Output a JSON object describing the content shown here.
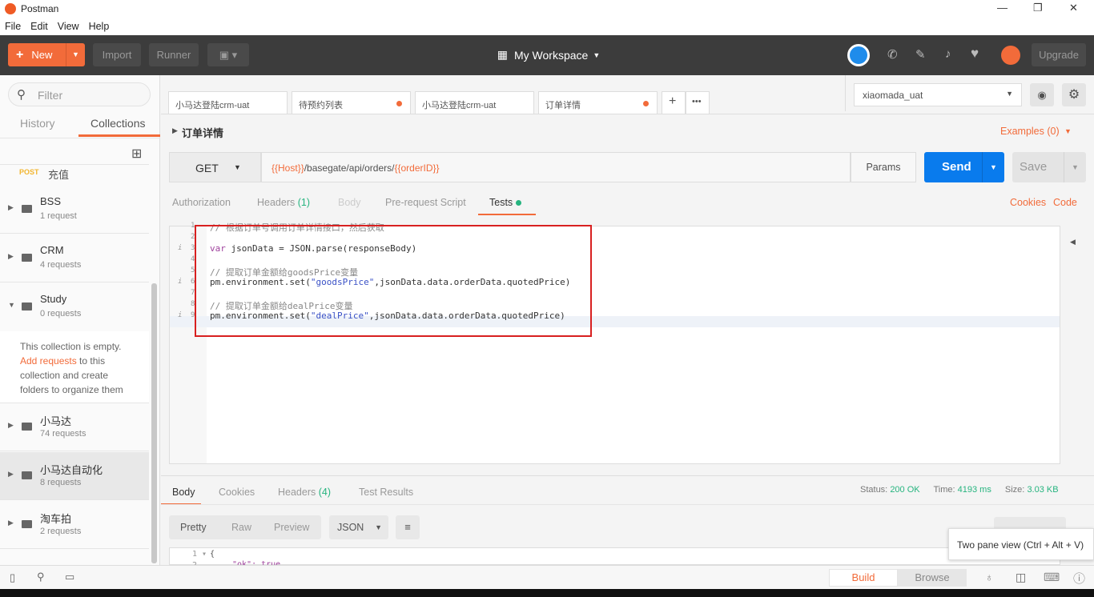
{
  "window": {
    "title": "Postman",
    "minimize": "—",
    "maximize": "❐",
    "close": "✕"
  },
  "menu": [
    "File",
    "Edit",
    "View",
    "Help"
  ],
  "toolbar": {
    "new": "New",
    "import": "Import",
    "runner": "Runner",
    "workspace": "My Workspace",
    "upgrade": "Upgrade"
  },
  "sidebar": {
    "filter_placeholder": "Filter",
    "tabs": [
      "History",
      "Collections"
    ],
    "partial_item": {
      "method": "POST",
      "name": "充值"
    },
    "collections": [
      {
        "name": "BSS",
        "count": "1 request"
      },
      {
        "name": "CRM",
        "count": "4 requests"
      },
      {
        "name": "Study",
        "count": "0 requests"
      },
      {
        "name": "小马达",
        "count": "74 requests"
      },
      {
        "name": "小马达自动化",
        "count": "8 requests"
      },
      {
        "name": "淘车拍",
        "count": "2 requests"
      }
    ],
    "empty_1": "This collection is empty.",
    "empty_link": "Add requests",
    "empty_2": " to this",
    "empty_3": "collection and create",
    "empty_4": "folders to organize them"
  },
  "tabs": [
    "小马达登陆crm-uat",
    "待预约列表",
    "小马达登陆crm-uat",
    "订单详情"
  ],
  "environment": "xiaomada_uat",
  "request": {
    "name": "订单详情",
    "examples": "Examples (0)",
    "method": "GET",
    "url_host": "{{Host}}",
    "url_path": "/basegate/api/orders/",
    "url_var": "{{orderID}}",
    "params": "Params",
    "send": "Send",
    "save": "Save"
  },
  "req_tabs": {
    "auth": "Authorization",
    "headers": "Headers",
    "headers_count": "(1)",
    "body": "Body",
    "prereq": "Pre-request Script",
    "tests": "Tests",
    "cookies": "Cookies",
    "code": "Code"
  },
  "code_lines": [
    {
      "n": "1",
      "parts": [
        {
          "c": "cm",
          "t": "// 根据订单号调用订单详情接口，然后获取"
        }
      ]
    },
    {
      "n": "2",
      "parts": []
    },
    {
      "n": "3",
      "info": "i",
      "parts": [
        {
          "c": "kw",
          "t": "var"
        },
        {
          "c": "",
          "t": " jsonData = JSON.parse(responseBody)"
        }
      ]
    },
    {
      "n": "4",
      "parts": []
    },
    {
      "n": "5",
      "parts": [
        {
          "c": "cm",
          "t": "// 提取订单金额给goodsPrice变量"
        }
      ]
    },
    {
      "n": "6",
      "info": "i",
      "parts": [
        {
          "c": "",
          "t": "pm.environment.set("
        },
        {
          "c": "str",
          "t": "\"goodsPrice\""
        },
        {
          "c": "",
          "t": ",jsonData.data.orderData.quotedPrice)"
        }
      ]
    },
    {
      "n": "7",
      "parts": []
    },
    {
      "n": "8",
      "parts": [
        {
          "c": "cm",
          "t": "// 提取订单金额给dealPrice变量"
        }
      ]
    },
    {
      "n": "9",
      "info": "i",
      "parts": [
        {
          "c": "",
          "t": "pm.environment.set("
        },
        {
          "c": "str",
          "t": "\"dealPrice\""
        },
        {
          "c": "",
          "t": ",jsonData.data.orderData.quotedPrice)"
        }
      ]
    }
  ],
  "response": {
    "tabs": [
      "Body",
      "Cookies",
      "Headers",
      "Test Results"
    ],
    "headers_count": "(4)",
    "status_label": "Status:",
    "status": "200 OK",
    "time_label": "Time:",
    "time": "4193 ms",
    "size_label": "Size:",
    "size": "3.03 KB",
    "views": [
      "Pretty",
      "Raw",
      "Preview"
    ],
    "format": "JSON",
    "line1": "{",
    "line2": "\"ok\": true,"
  },
  "tooltip": "Two pane view (Ctrl + Alt + V)",
  "statusbar": {
    "build": "Build",
    "browse": "Browse"
  },
  "colors": {
    "accent": "#f26b3a",
    "send": "#097bed",
    "ok": "#26b47f",
    "highlight_box": "#d82020"
  }
}
